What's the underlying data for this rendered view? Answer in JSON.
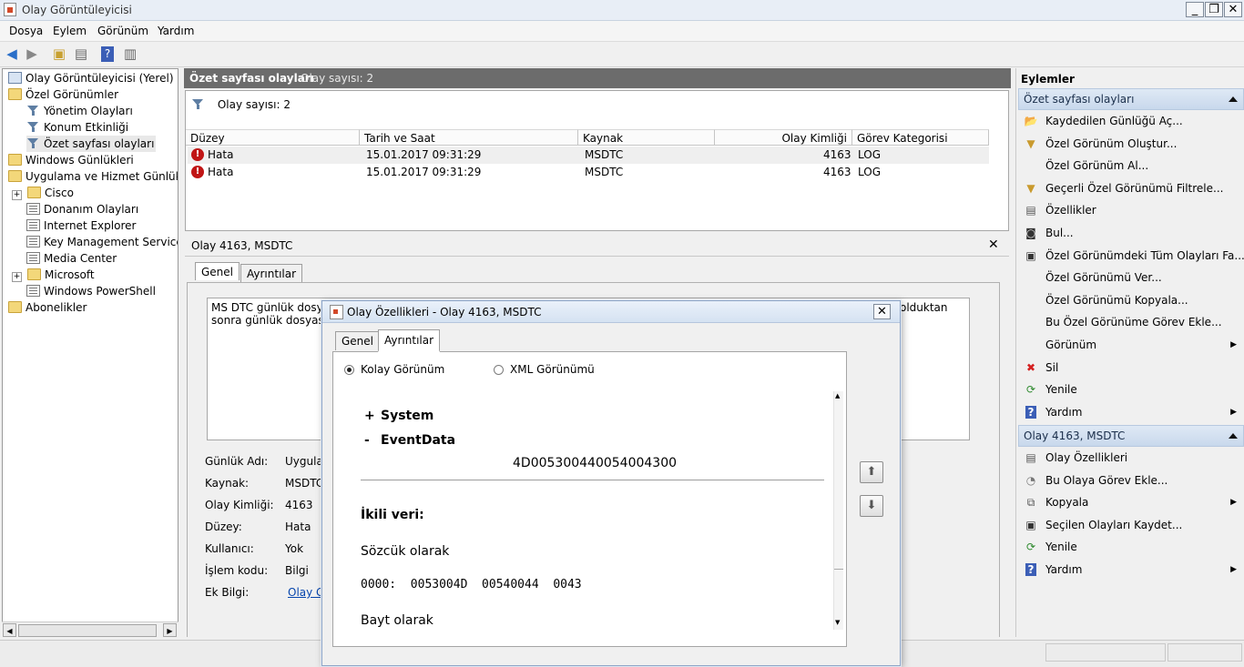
{
  "window": {
    "title": "Olay Görüntüleyicisi",
    "minimize": "_",
    "maximize": "❐",
    "close": "✕"
  },
  "menu": [
    "Dosya",
    "Eylem",
    "Görünüm",
    "Yardım"
  ],
  "tree": {
    "root": "Olay Görüntüleyicisi (Yerel)",
    "custom_views": "Özel Görünümler",
    "admin_events": "Yönetim Olayları",
    "location_activity": "Konum Etkinliği",
    "summary_events": "Özet sayfası olayları",
    "windows_logs": "Windows Günlükleri",
    "app_service_logs": "Uygulama ve Hizmet Günlükleri",
    "cisco": "Cisco",
    "hardware_events": "Donanım Olayları",
    "internet_explorer": "Internet Explorer",
    "key_management": "Key Management Service",
    "media_center": "Media Center",
    "microsoft": "Microsoft",
    "powershell": "Windows PowerShell",
    "subscriptions": "Abonelikler"
  },
  "center": {
    "title": "Özet sayfası olayları",
    "count_label": "Olay sayısı: 2",
    "filter_label": "Olay sayısı: 2",
    "columns": [
      "Düzey",
      "Tarih ve Saat",
      "Kaynak",
      "Olay Kimliği",
      "Görev Kategorisi"
    ],
    "rows": [
      {
        "level": "Hata",
        "datetime": "15.01.2017 09:31:29",
        "source": "MSDTC",
        "event_id": "4163",
        "category": "LOG"
      },
      {
        "level": "Hata",
        "datetime": "15.01.2017 09:31:29",
        "source": "MSDTC",
        "event_id": "4163",
        "category": "LOG"
      }
    ]
  },
  "detail": {
    "title": "Olay 4163, MSDTC",
    "tabs": [
      "Genel",
      "Ayrıntılar"
    ],
    "desc_line1": "MS DTC günlük dosyas",
    "desc_line1_tail": "olduktan",
    "desc_line2": "sonra günlük dosyasını",
    "fields": [
      {
        "label": "Günlük Adı:",
        "value": "Uygula"
      },
      {
        "label": "Kaynak:",
        "value": "MSDTC"
      },
      {
        "label": "Olay Kimliği:",
        "value": "4163"
      },
      {
        "label": "Düzey:",
        "value": "Hata"
      },
      {
        "label": "Kullanıcı:",
        "value": "Yok"
      },
      {
        "label": "İşlem kodu:",
        "value": "Bilgi"
      },
      {
        "label": "Ek Bilgi:",
        "value": "Olay G"
      }
    ]
  },
  "actions": {
    "title": "Eylemler",
    "section1": "Özet sayfası olayları",
    "items1": [
      {
        "label": "Kaydedilen Günlüğü Aç...",
        "icon": "folder-open-icon"
      },
      {
        "label": "Özel Görünüm Oluştur...",
        "icon": "filter-icon"
      },
      {
        "label": "Özel Görünüm Al...",
        "icon": ""
      },
      {
        "label": "Geçerli Özel Görünümü Filtrele...",
        "icon": "filter-icon"
      },
      {
        "label": "Özellikler",
        "icon": "properties-icon"
      },
      {
        "label": "Bul...",
        "icon": "binoculars-icon"
      },
      {
        "label": "Özel Görünümdeki Tüm Olayları Fa...",
        "icon": "save-icon"
      },
      {
        "label": "Özel Görünümü Ver...",
        "icon": ""
      },
      {
        "label": "Özel Görünümü Kopyala...",
        "icon": ""
      },
      {
        "label": "Bu Özel Görünüme Görev Ekle...",
        "icon": ""
      },
      {
        "label": "Görünüm",
        "icon": "",
        "submenu": true
      },
      {
        "label": "Sil",
        "icon": "delete-icon"
      },
      {
        "label": "Yenile",
        "icon": "refresh-icon"
      },
      {
        "label": "Yardım",
        "icon": "help-icon",
        "submenu": true
      }
    ],
    "section2": "Olay 4163, MSDTC",
    "items2": [
      {
        "label": "Olay Özellikleri",
        "icon": "properties-icon"
      },
      {
        "label": "Bu Olaya Görev Ekle...",
        "icon": "task-icon"
      },
      {
        "label": "Kopyala",
        "icon": "copy-icon",
        "submenu": true
      },
      {
        "label": "Seçilen Olayları Kaydet...",
        "icon": "save-icon"
      },
      {
        "label": "Yenile",
        "icon": "refresh-icon"
      },
      {
        "label": "Yardım",
        "icon": "help-icon",
        "submenu": true
      }
    ]
  },
  "dialog": {
    "title": "Olay Özellikleri - Olay 4163, MSDTC",
    "tabs": [
      "Genel",
      "Ayrıntılar"
    ],
    "radio_friendly": "Kolay Görünüm",
    "radio_xml": "XML Görünümü",
    "system_label": "System",
    "eventdata_label": "EventData",
    "plus": "+",
    "minus": "-",
    "hex_value": "4D005300440054004300",
    "binary_label": "İkili veri:",
    "words_label": "Sözcük olarak",
    "words_line": "0000:  0053004D  00540044  0043",
    "bytes_label": "Bayt olarak"
  },
  "colors": {
    "accent_header": "#6c6c6c",
    "error": "#c01515",
    "section_bg": "#d3e1f1"
  }
}
